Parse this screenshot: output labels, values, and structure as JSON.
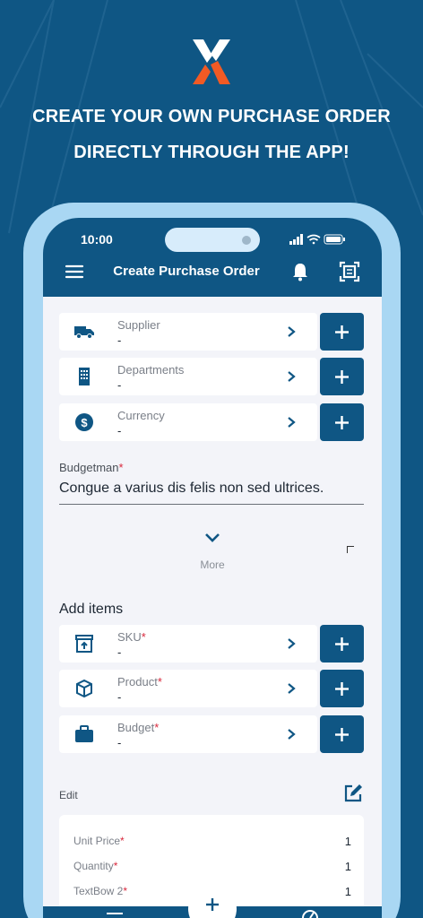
{
  "brand": {
    "logo_icon": "x-logo-icon",
    "accent": "#f15a24",
    "primary": "#0f5684",
    "frame": "#a9d7f3"
  },
  "headline": {
    "line1": "CREATE YOUR OWN PURCHASE ORDER",
    "line2": "DIRECTLY THROUGH THE APP!"
  },
  "status_bar": {
    "time": "10:00",
    "icons": [
      "signal-icon",
      "wifi-icon",
      "battery-icon"
    ]
  },
  "appbar": {
    "title": "Create Purchase Order",
    "menu_icon": "hamburger-icon",
    "bell_icon": "bell-icon",
    "scan_icon": "scan-icon"
  },
  "header_fields": [
    {
      "label": "Supplier",
      "value": "-",
      "icon": "truck-icon",
      "required": false
    },
    {
      "label": "Departments",
      "value": "-",
      "icon": "building-icon",
      "required": false
    },
    {
      "label": "Currency",
      "value": "-",
      "icon": "dollar-icon",
      "required": false
    }
  ],
  "budgetman": {
    "label": "Budgetman",
    "required_mark": "*",
    "value": "Congue a varius dis felis non sed ultrices."
  },
  "more": {
    "label": "More"
  },
  "add_items": {
    "title": "Add items",
    "fields": [
      {
        "label": "SKU",
        "value": "-",
        "icon": "archive-icon",
        "required_mark": "*"
      },
      {
        "label": "Product",
        "value": "-",
        "icon": "cube-icon",
        "required_mark": "*"
      },
      {
        "label": "Budget",
        "value": "-",
        "icon": "briefcase-icon",
        "required_mark": "*"
      }
    ]
  },
  "edit": {
    "label": "Edit"
  },
  "summary": [
    {
      "label": "Unit Price",
      "required_mark": "*",
      "value": "1"
    },
    {
      "label": "Quantity",
      "required_mark": "*",
      "value": "1"
    },
    {
      "label": "TextBow 2",
      "required_mark": "*",
      "value": "1"
    }
  ]
}
